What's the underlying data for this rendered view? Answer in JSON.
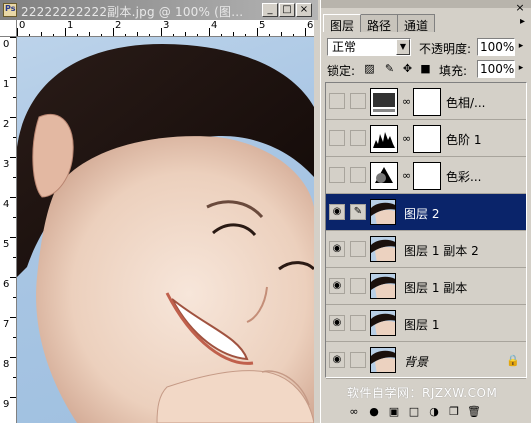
{
  "document": {
    "title": "22222222222副本.jpg @ 100% (图...",
    "ruler_top": [
      "0",
      "1",
      "2",
      "3",
      "4",
      "5",
      "6"
    ],
    "ruler_left": [
      "0",
      "1",
      "2",
      "3",
      "4",
      "5",
      "6",
      "7",
      "8",
      "9"
    ],
    "window_buttons": [
      "_",
      "□",
      "×"
    ]
  },
  "palette": {
    "tabs": [
      "图层",
      "路径",
      "通道"
    ],
    "blend_mode": "正常",
    "opacity_label": "不透明度:",
    "opacity_value": "100%",
    "lock_label": "锁定:",
    "fill_label": "填充:",
    "fill_value": "100%",
    "layers": [
      {
        "name": "色相/...",
        "type": "adjustment",
        "visible": false,
        "selected": false,
        "icon": "hue-saturation-icon"
      },
      {
        "name": "色阶 1",
        "type": "adjustment",
        "visible": false,
        "selected": false,
        "icon": "levels-icon"
      },
      {
        "name": "色彩...",
        "type": "adjustment",
        "visible": false,
        "selected": false,
        "icon": "color-balance-icon"
      },
      {
        "name": "图层 2",
        "type": "image",
        "visible": true,
        "selected": true,
        "icon": "brush-icon"
      },
      {
        "name": "图层 1 副本 2",
        "type": "image",
        "visible": true,
        "selected": false
      },
      {
        "name": "图层 1 副本",
        "type": "image",
        "visible": true,
        "selected": false
      },
      {
        "name": "图层 1",
        "type": "image",
        "visible": true,
        "selected": false
      },
      {
        "name": "背景",
        "type": "image",
        "visible": true,
        "selected": false,
        "locked": true
      }
    ],
    "watermark": "软件自学网：RJZXW.COM",
    "bottom_icons": [
      "link-layers-icon",
      "layer-style-icon",
      "add-mask-icon",
      "new-group-icon",
      "adjustment-layer-icon",
      "new-layer-icon",
      "delete-layer-icon"
    ]
  },
  "colors": {
    "selected_row": "#0a246a",
    "panel_bg": "#d4d0c8",
    "sky": "#a9c6e4"
  }
}
